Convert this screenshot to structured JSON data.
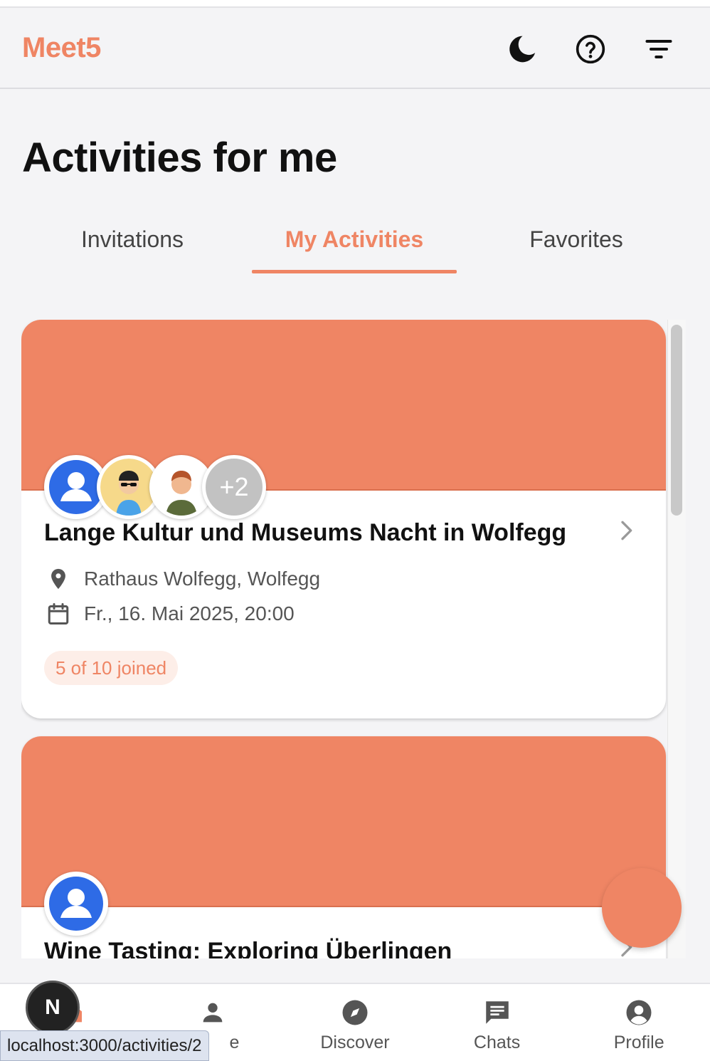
{
  "app": {
    "brand": "Meet5"
  },
  "header": {
    "icons": [
      "moon-icon",
      "help-icon",
      "filter-icon"
    ]
  },
  "page": {
    "title": "Activities for me"
  },
  "tabs": [
    {
      "label": "Invitations",
      "active": false
    },
    {
      "label": "My Activities",
      "active": true
    },
    {
      "label": "Favorites",
      "active": false
    }
  ],
  "cards": [
    {
      "title": "Lange Kultur und Museums Nacht in Wolfegg",
      "location": "Rathaus Wolfegg, Wolfegg",
      "datetime": "Fr., 16. Mai 2025, 20:00",
      "joined": "5 of 10 joined",
      "more_avatars": "+2"
    },
    {
      "title": "Wine Tasting: Exploring Überlingen"
    }
  ],
  "bottom_nav": [
    {
      "label": "",
      "icon": "home-icon"
    },
    {
      "label": "e",
      "icon": "person-icon"
    },
    {
      "label": "Discover",
      "icon": "compass-icon"
    },
    {
      "label": "Chats",
      "icon": "chat-icon"
    },
    {
      "label": "Profile",
      "icon": "account-circle-icon"
    }
  ],
  "dev": {
    "badge": "N",
    "url": "localhost:3000/activities/2"
  },
  "colors": {
    "accent": "#ef8564"
  }
}
